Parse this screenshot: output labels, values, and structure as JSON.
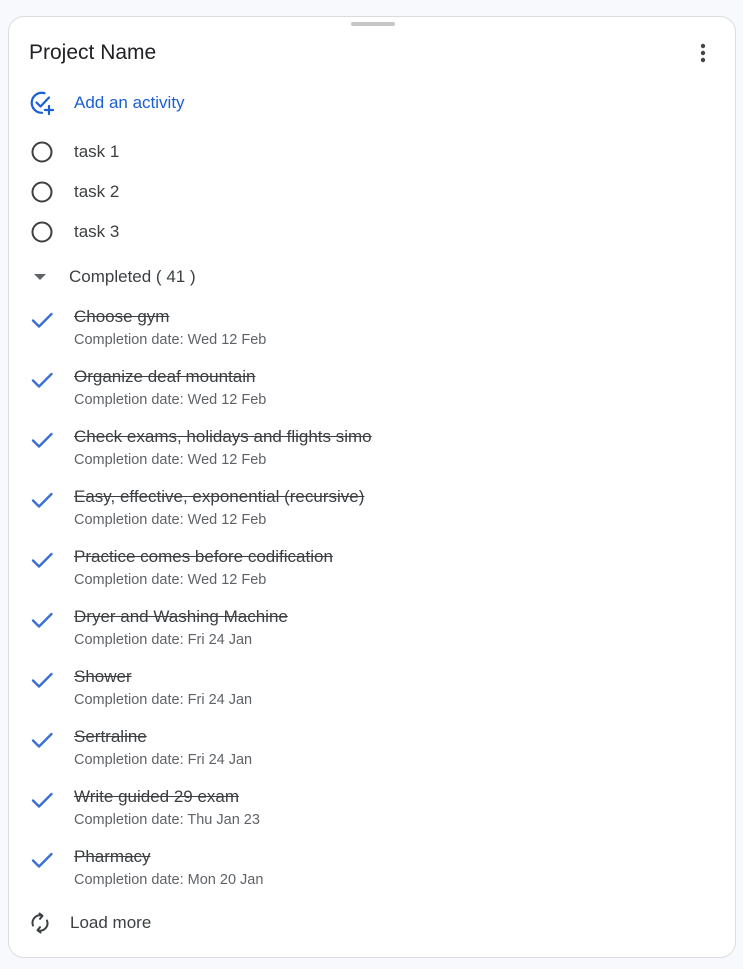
{
  "panel": {
    "title": "Project Name",
    "menu_icon": "more-vert-icon"
  },
  "add_activity": {
    "label": "Add an activity",
    "icon": "add-task-icon",
    "color": "#1a5fd6"
  },
  "tasks": [
    {
      "label": "task 1"
    },
    {
      "label": "task 2"
    },
    {
      "label": "task 3"
    }
  ],
  "completed": {
    "label": "Completed ( 41 )",
    "expanded": true,
    "items": [
      {
        "title": "Choose gym",
        "date": "Completion date: Wed 12 Feb"
      },
      {
        "title": "Organize deaf mountain",
        "date": "Completion date: Wed 12 Feb"
      },
      {
        "title": "Check exams, holidays and flights simo",
        "date": "Completion date: Wed 12 Feb"
      },
      {
        "title": "Easy, effective, exponential (recursive)",
        "date": "Completion date: Wed 12 Feb"
      },
      {
        "title": "Practice comes before codification",
        "date": "Completion date: Wed 12 Feb"
      },
      {
        "title": "Dryer and Washing Machine",
        "date": "Completion date: Fri 24 Jan"
      },
      {
        "title": "Shower",
        "date": "Completion date: Fri 24 Jan"
      },
      {
        "title": "Sertraline",
        "date": "Completion date: Fri 24 Jan"
      },
      {
        "title": "Write guided 29 exam",
        "date": "Completion date: Thu Jan 23"
      },
      {
        "title": "Pharmacy",
        "date": "Completion date: Mon 20 Jan"
      }
    ]
  },
  "load_more": {
    "label": "Load more",
    "icon": "refresh-icon"
  },
  "colors": {
    "accent": "#1a5fd6",
    "check": "#3b6fd4",
    "text": "#3c4043",
    "secondary_text": "#5f6368"
  }
}
